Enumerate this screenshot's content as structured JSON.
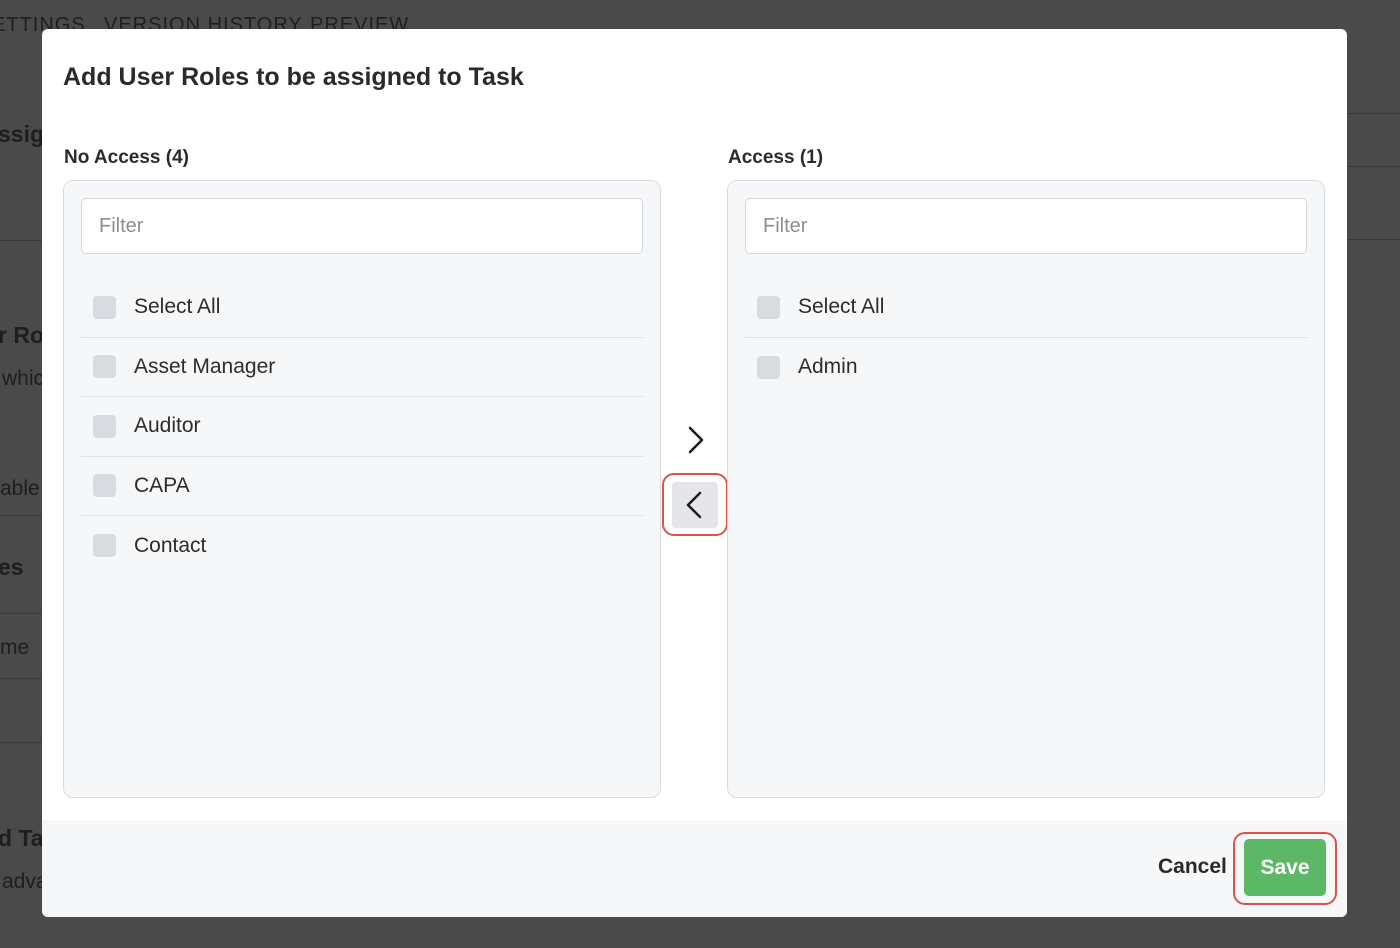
{
  "background": {
    "tabs": [
      "ETTINGS",
      "VERSION HISTORY",
      "PREVIEW"
    ],
    "fragments": [
      "ssign",
      "r Ro",
      "whic",
      "able",
      "es",
      "me",
      "d Ta",
      "adva"
    ]
  },
  "modal": {
    "title": "Add User Roles to be assigned to Task",
    "left_panel": {
      "label": "No Access (4)",
      "filter_placeholder": "Filter",
      "items": [
        "Select All",
        "Asset Manager",
        "Auditor",
        "CAPA",
        "Contact"
      ]
    },
    "right_panel": {
      "label": "Access (1)",
      "filter_placeholder": "Filter",
      "items": [
        "Select All",
        "Admin"
      ]
    },
    "icons": {
      "move_right": "chevron-right-icon",
      "move_left": "chevron-left-icon"
    },
    "footer": {
      "cancel_label": "Cancel",
      "save_label": "Save"
    }
  },
  "colors": {
    "save_button": "#5cb866",
    "highlight": "#d9534a",
    "overlay": "#4a4a4a"
  }
}
